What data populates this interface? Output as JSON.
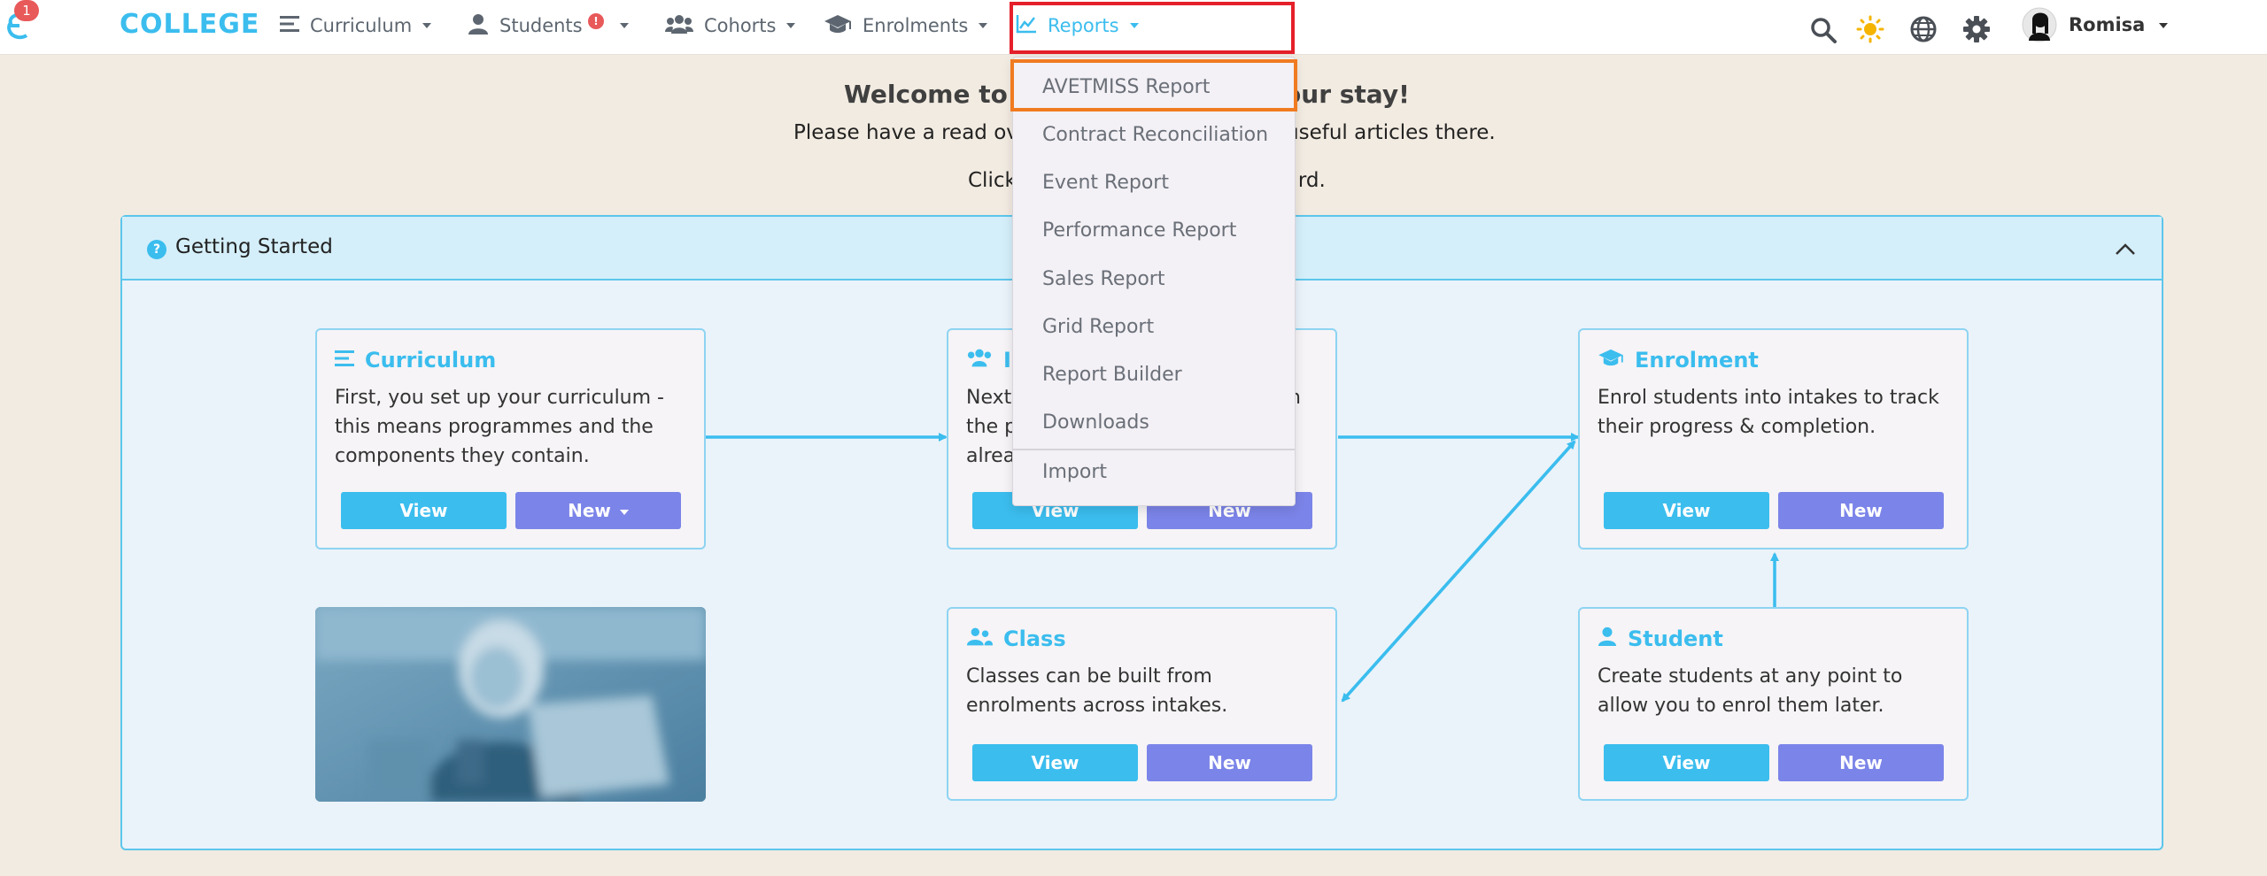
{
  "navbar": {
    "notification_count": "1",
    "brand": "COLLEGE",
    "items": [
      {
        "label": "Curriculum"
      },
      {
        "label": "Students",
        "alert": "!"
      },
      {
        "label": "Cohorts"
      },
      {
        "label": "Enrolments"
      },
      {
        "label": "Reports"
      }
    ],
    "user_name": "Romisa"
  },
  "welcome": {
    "title_left": "Welcome to S",
    "title_right": "y your stay!",
    "line1_left": "Please have a read ove",
    "line1_right": "useful articles there.",
    "line2_left": "Click",
    "line2_right": "rd."
  },
  "panel": {
    "title": "Getting Started",
    "help_icon": "?"
  },
  "cards": {
    "curriculum": {
      "title": "Curriculum",
      "text": "First, you set up your curriculum - this means programmes and the components they contain.",
      "view": "View",
      "new": "New"
    },
    "intake": {
      "title": "In",
      "text_lines": [
        "Next,",
        "the p",
        "alrea"
      ],
      "text_right": "n",
      "view": "View",
      "new": "New"
    },
    "enrolment": {
      "title": "Enrolment",
      "text": "Enrol students into intakes to track their progress & completion.",
      "view": "View",
      "new": "New"
    },
    "class": {
      "title": "Class",
      "text": "Classes can be built from enrolments across intakes.",
      "view": "View",
      "new": "New"
    },
    "student": {
      "title": "Student",
      "text": "Create students at any point to allow you to enrol them later.",
      "view": "View",
      "new": "New"
    }
  },
  "reports_menu": {
    "items": [
      "AVETMISS Report",
      "Contract Reconciliation",
      "Event Report",
      "Performance Report",
      "Sales Report",
      "Grid Report",
      "Report Builder",
      "Downloads"
    ],
    "import": "Import"
  },
  "colors": {
    "accent": "#3bbdee",
    "new_button": "#7b84e8",
    "highlight_red": "#e5202a",
    "highlight_orange": "#f07b21",
    "background": "#f2ebe1"
  }
}
